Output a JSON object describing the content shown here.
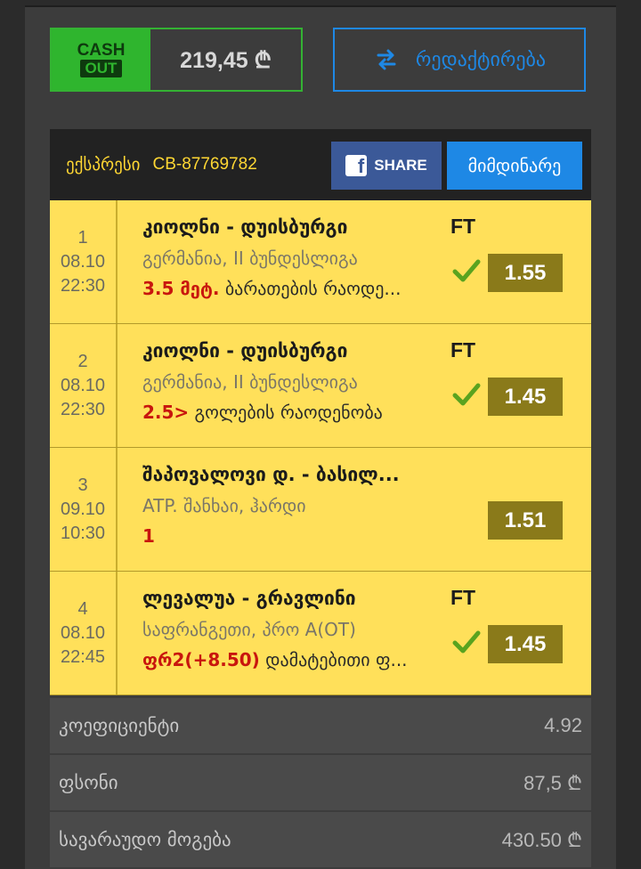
{
  "cashout": {
    "cash_label": "CASH",
    "out_label": "OUT",
    "amount": "219,45 ₾"
  },
  "edit": {
    "label": "რედაქტირება"
  },
  "card": {
    "type_label": "ექსპრესი",
    "code": "CB-87769782",
    "share_label": "SHARE",
    "status_label": "მიმდინარე"
  },
  "bets": [
    {
      "index": "1",
      "date": "08.10",
      "time": "22:30",
      "teams": "კიოლნი - დუისბურგი",
      "league": "გერმანია, II ბუნდესლიგა",
      "pick": "3.5 მეტ.",
      "market": " ბარათების რაოდე...",
      "status": "FT",
      "won": true,
      "odds": "1.55"
    },
    {
      "index": "2",
      "date": "08.10",
      "time": "22:30",
      "teams": "კიოლნი - დუისბურგი",
      "league": "გერმანია, II ბუნდესლიგა",
      "pick": "2.5>",
      "market": " გოლების რაოდენობა",
      "status": "FT",
      "won": true,
      "odds": "1.45"
    },
    {
      "index": "3",
      "date": "09.10",
      "time": "10:30",
      "teams": "შაპოვალოვი დ. - ბასილ...",
      "league": "ATP. შანხაი, ჰარდი",
      "pick": "1",
      "market": "",
      "status": "",
      "won": false,
      "odds": "1.51"
    },
    {
      "index": "4",
      "date": "08.10",
      "time": "22:45",
      "teams": "ლევალუა - გრავლინი",
      "league": "საფრანგეთი, პრო A(OT)",
      "pick": "ფრ2(+8.50)",
      "market": " დამატებითი ფ...",
      "status": "FT",
      "won": true,
      "odds": "1.45"
    }
  ],
  "summary": [
    {
      "label": "კოეფიციენტი",
      "value": "4.92"
    },
    {
      "label": "ფსონი",
      "value": "87,5 ₾"
    },
    {
      "label": "სავარაუდო მოგება",
      "value": "430.50 ₾"
    }
  ],
  "colors": {
    "accent_blue": "#1e88e5",
    "cashout_green": "#2fb52e",
    "bet_yellow": "#ffe05a",
    "odds_olive": "#8a7a1a",
    "pick_red": "#c8160e"
  }
}
